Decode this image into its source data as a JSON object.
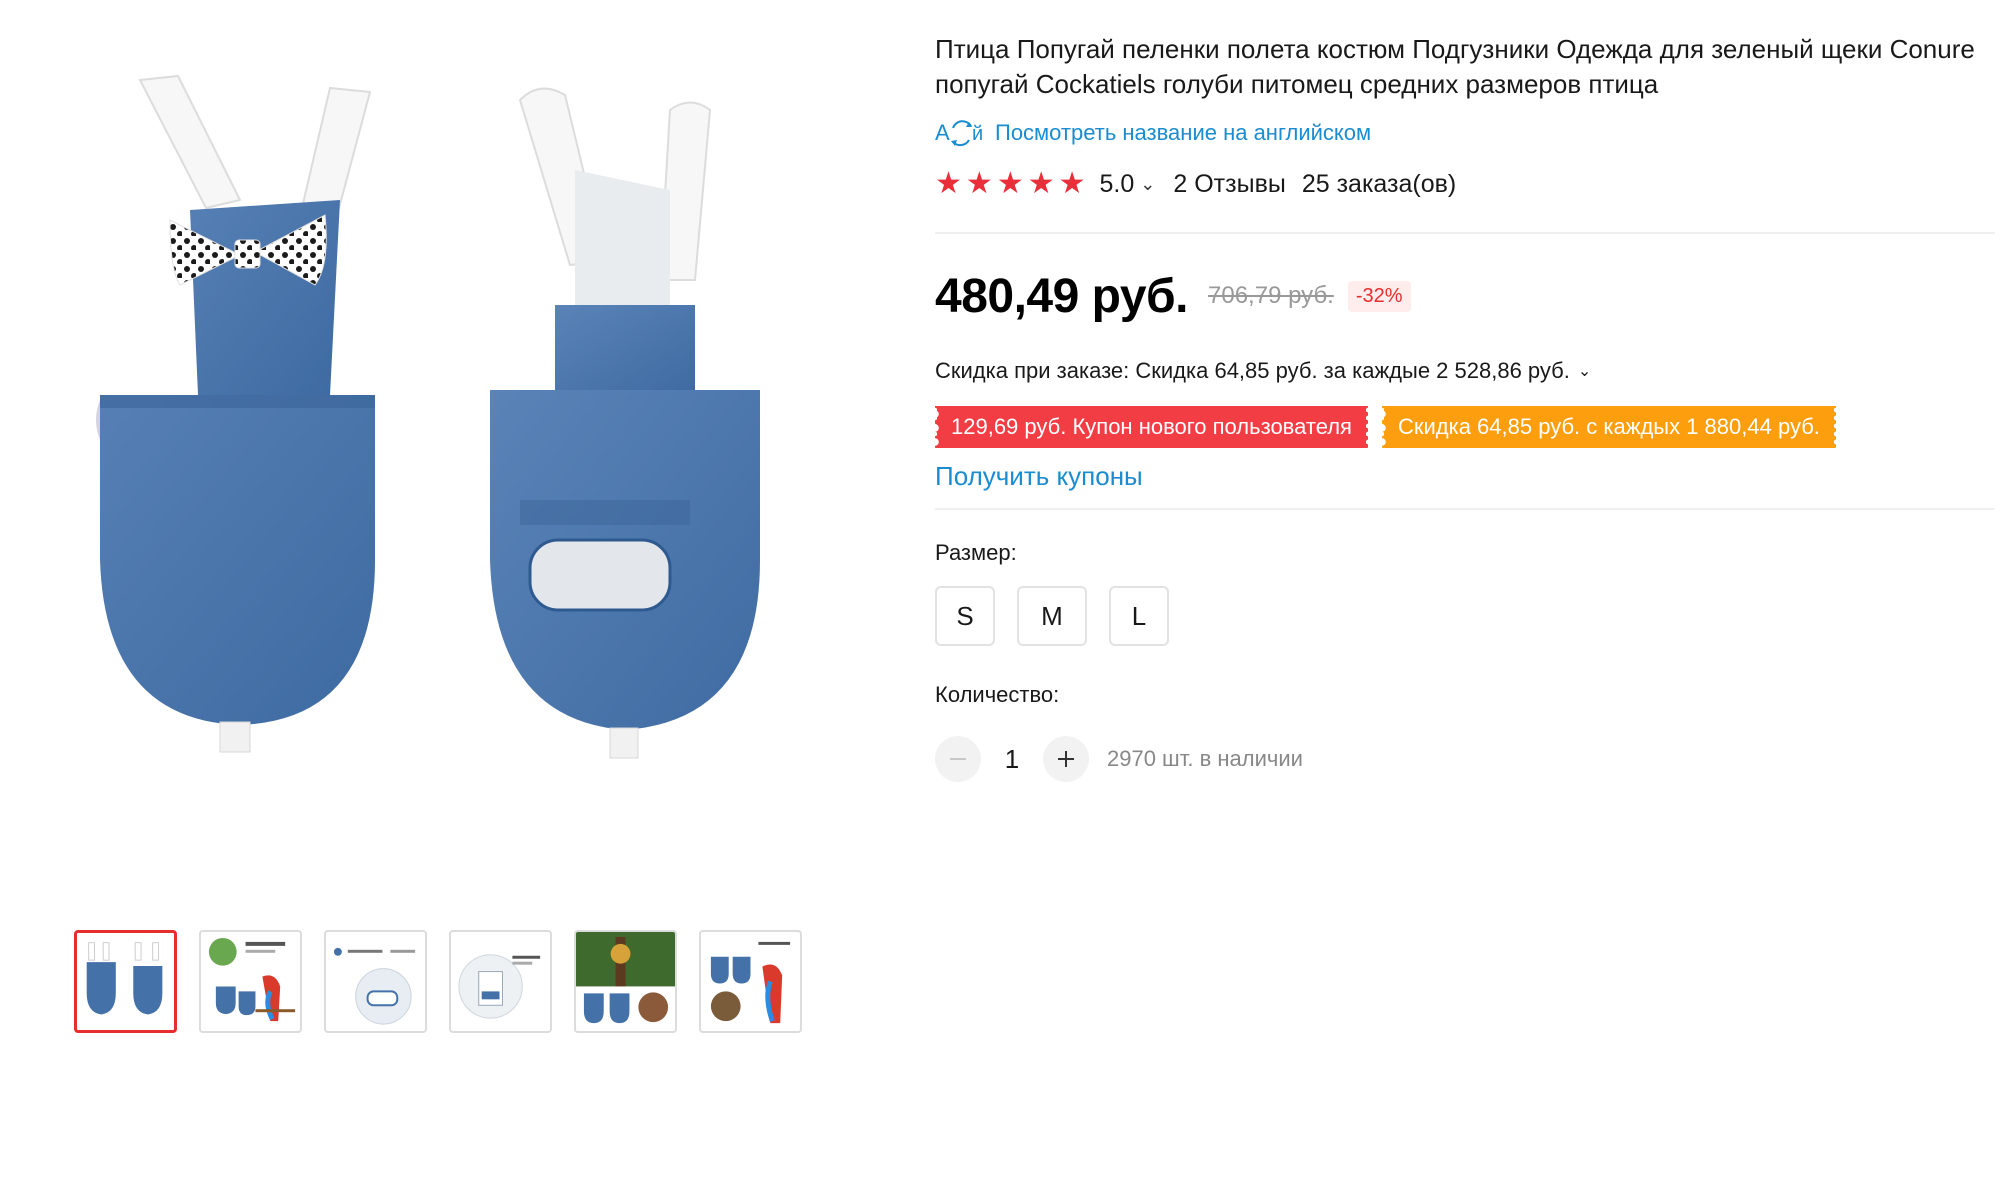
{
  "product": {
    "title": "Птица Попугай пеленки полета костюм Подгузники Одежда для зеленый щеки Conure попугай Cockatiels голуби питомец средних размеров птица",
    "translate_link": "Посмотреть название на английском",
    "rating": {
      "stars": 5,
      "value": "5.0",
      "reviews": "2 Отзывы",
      "orders": "25 заказа(ов)"
    },
    "price": {
      "current": "480,49 руб.",
      "original": "706,79 руб.",
      "discount": "-32%"
    },
    "bulk_discount": "Скидка при заказе: Скидка 64,85 руб. за каждые 2 528,86 руб.",
    "coupons": [
      {
        "label": "129,69 руб. Купон нового пользователя",
        "color": "#f33d44"
      },
      {
        "label": "Скидка 64,85 руб. с каждых 1 880,44 руб.",
        "color": "#fd9e0f"
      }
    ],
    "get_coupons": "Получить купоны",
    "size": {
      "label": "Размер:",
      "options": [
        "S",
        "M",
        "L"
      ]
    },
    "quantity": {
      "label": "Количество:",
      "value": "1",
      "stock": "2970 шт. в наличии"
    }
  },
  "gallery": {
    "thumbnail_count": 6,
    "active_index": 0
  },
  "colors": {
    "link": "#1a8ccf",
    "star": "#e92f3a",
    "active_thumb_border": "#e62e2e",
    "denim": "#4471a8"
  }
}
